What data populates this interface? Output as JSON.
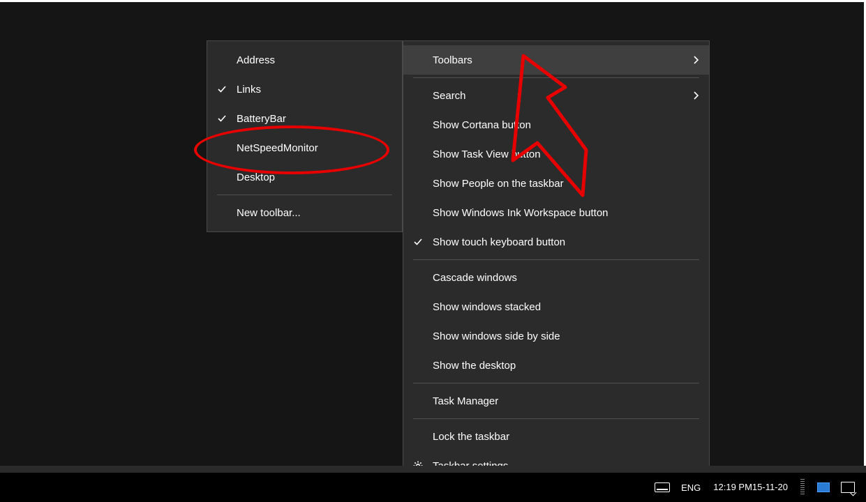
{
  "toolbars_submenu": {
    "items": [
      {
        "label": "Address",
        "checked": false
      },
      {
        "label": "Links",
        "checked": true
      },
      {
        "label": "BatteryBar",
        "checked": true
      },
      {
        "label": "NetSpeedMonitor",
        "checked": false
      },
      {
        "label": "Desktop",
        "checked": false
      }
    ],
    "new_toolbar_label": "New toolbar..."
  },
  "taskbar_menu": {
    "toolbars_label": "Toolbars",
    "search_label": "Search",
    "show_cortana_label": "Show Cortana button",
    "show_taskview_label": "Show Task View button",
    "show_people_label": "Show People on the taskbar",
    "show_ink_label": "Show Windows Ink Workspace button",
    "show_touchkbd_label": "Show touch keyboard button",
    "show_touchkbd_checked": true,
    "cascade_label": "Cascade windows",
    "stacked_label": "Show windows stacked",
    "sidebyside_label": "Show windows side by side",
    "show_desktop_label": "Show the desktop",
    "task_manager_label": "Task Manager",
    "lock_taskbar_label": "Lock the taskbar",
    "taskbar_settings_label": "Taskbar settings"
  },
  "taskbar": {
    "lang": "ENG",
    "time": "12:19 PM",
    "date": "15-11-20"
  }
}
